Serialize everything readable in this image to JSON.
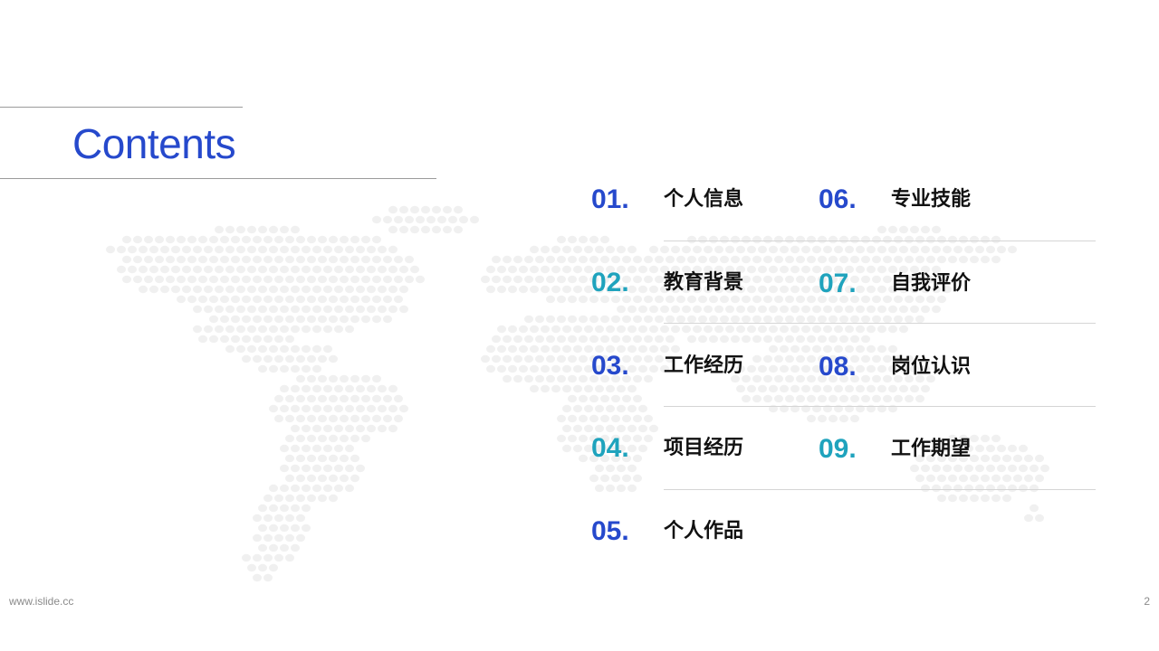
{
  "slide": {
    "title": "Contents",
    "footer_url": "www.islide.cc",
    "page_number": "2"
  },
  "colors": {
    "title": "#2649cc",
    "number_blue": "#2649cc",
    "number_teal": "#1fa3bd",
    "map_dots": "#f0f0f0",
    "rule": "#9a9a9a",
    "separator": "#d5d5d5"
  },
  "toc": {
    "items": [
      {
        "number": "01.",
        "label": "个人信息",
        "tone": "blue"
      },
      {
        "number": "02.",
        "label": "教育背景",
        "tone": "teal"
      },
      {
        "number": "03.",
        "label": "工作经历",
        "tone": "blue"
      },
      {
        "number": "04.",
        "label": "项目经历",
        "tone": "teal"
      },
      {
        "number": "05.",
        "label": "个人作品",
        "tone": "blue"
      },
      {
        "number": "06.",
        "label": "专业技能",
        "tone": "blue"
      },
      {
        "number": "07.",
        "label": "自我评价",
        "tone": "teal"
      },
      {
        "number": "08.",
        "label": "岗位认识",
        "tone": "blue"
      },
      {
        "number": "09.",
        "label": "工作期望",
        "tone": "teal"
      }
    ]
  }
}
